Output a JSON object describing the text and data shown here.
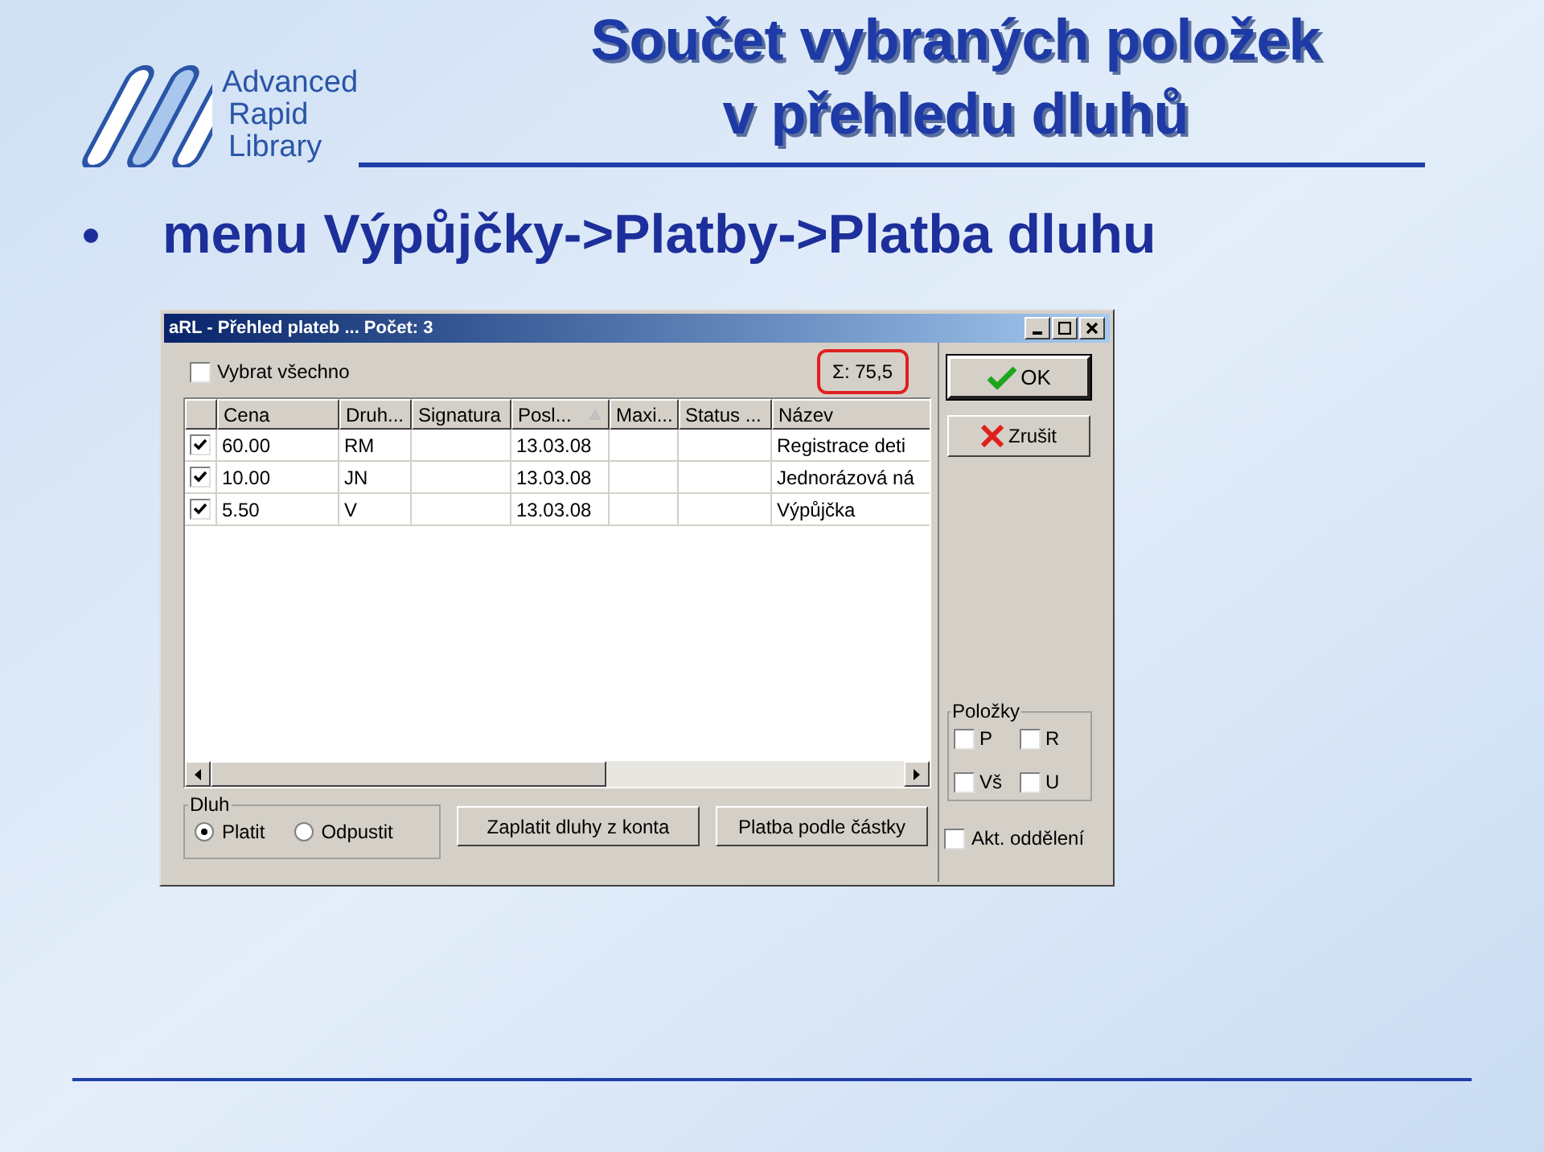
{
  "logo": {
    "lines": [
      "Advanced",
      "Rapid",
      "Library"
    ]
  },
  "title": [
    "Součet vybraných položek",
    "v přehledu dluhů"
  ],
  "bullet": "menu Výpůjčky->Platby->Platba dluhu",
  "window": {
    "title": "aRL - Přehled plateb ... Počet: 3",
    "select_all": {
      "label": "Vybrat všechno",
      "checked": false
    },
    "sum": "Σ: 75,5",
    "columns": [
      {
        "label": "Cena",
        "sorted": false
      },
      {
        "label": "Druh...",
        "sorted": false
      },
      {
        "label": "Signatura",
        "sorted": false
      },
      {
        "label": "Posl...",
        "sorted": true
      },
      {
        "label": "Maxi...",
        "sorted": false
      },
      {
        "label": "Status ...",
        "sorted": false
      },
      {
        "label": "Název",
        "sorted": false
      }
    ],
    "rows": [
      {
        "checked": true,
        "cells": [
          "60.00",
          "RM",
          "",
          "13.03.08",
          "",
          "",
          "Registrace deti"
        ]
      },
      {
        "checked": true,
        "cells": [
          "10.00",
          "JN",
          "",
          "13.03.08",
          "",
          "",
          "Jednorázová ná"
        ]
      },
      {
        "checked": true,
        "cells": [
          "5.50",
          "V",
          "",
          "13.03.08",
          "",
          "",
          "Výpůjčka"
        ]
      }
    ],
    "dluh": {
      "title": "Dluh",
      "options": [
        {
          "label": "Platit",
          "selected": true
        },
        {
          "label": "Odpustit",
          "selected": false
        }
      ]
    },
    "buttons": [
      "Zaplatit dluhy z konta",
      "Platba podle částky"
    ],
    "ok": "OK",
    "cancel": "Zrušit",
    "polozky": {
      "title": "Položky",
      "items": [
        {
          "label": "P",
          "checked": false
        },
        {
          "label": "R",
          "checked": false
        },
        {
          "label": "Vš",
          "checked": false
        },
        {
          "label": "U",
          "checked": false
        }
      ]
    },
    "akt": {
      "label": "Akt. oddělení",
      "checked": false
    }
  }
}
